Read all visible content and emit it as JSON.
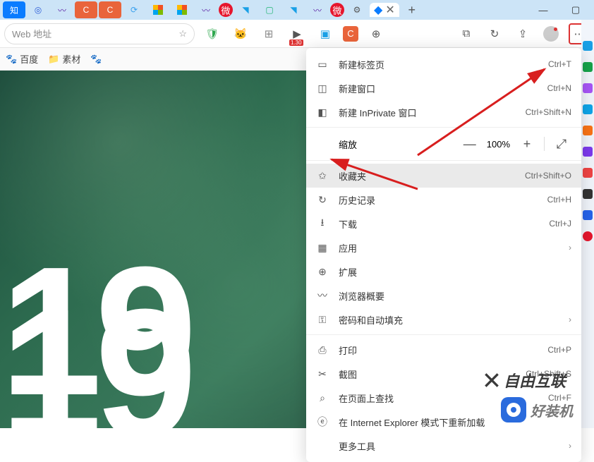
{
  "addressbar": {
    "placeholder": "Web 地址"
  },
  "bookmarks": {
    "baidu": "百度",
    "sucai": "素材"
  },
  "toolbar_badge": "1.30",
  "content": {
    "num1": "19",
    "num2": "19"
  },
  "zoom": {
    "label": "缩放",
    "value": "100%"
  },
  "menu": {
    "new_tab": {
      "label": "新建标签页",
      "shortcut": "Ctrl+T"
    },
    "new_window": {
      "label": "新建窗口",
      "shortcut": "Ctrl+N"
    },
    "new_inprivate": {
      "label": "新建 InPrivate 窗口",
      "shortcut": "Ctrl+Shift+N"
    },
    "favorites": {
      "label": "收藏夹",
      "shortcut": "Ctrl+Shift+O"
    },
    "history": {
      "label": "历史记录",
      "shortcut": "Ctrl+H"
    },
    "downloads": {
      "label": "下载",
      "shortcut": "Ctrl+J"
    },
    "apps": {
      "label": "应用"
    },
    "extensions": {
      "label": "扩展"
    },
    "browser_overview": {
      "label": "浏览器概要"
    },
    "passwords": {
      "label": "密码和自动填充"
    },
    "print": {
      "label": "打印",
      "shortcut": "Ctrl+P"
    },
    "screenshot": {
      "label": "截图",
      "shortcut": "Ctrl+Shift+S"
    },
    "find": {
      "label": "在页面上查找",
      "shortcut": "Ctrl+F"
    },
    "ie_mode": {
      "label": "在 Internet Explorer 模式下重新加载"
    },
    "more_tools": {
      "label": "更多工具"
    }
  },
  "watermarks": {
    "w1": "好装机",
    "w2": "自由互联"
  }
}
